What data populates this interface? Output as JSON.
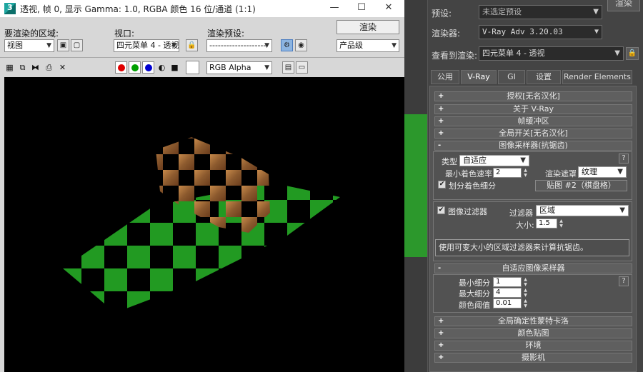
{
  "framebuffer": {
    "title": "透视, 帧 0, 显示 Gamma: 1.0, RGBA 颜色 16 位/通道 (1:1)",
    "controls": {
      "area_label": "要渲染的区域:",
      "area_value": "视图",
      "viewport_label": "视口:",
      "viewport_value": "四元菜单 4 - 透视",
      "preset_label": "渲染预设:",
      "preset_value": "--------------------",
      "render_button": "渲染",
      "quality_value": "产品级",
      "channel_value": "RGB Alpha"
    },
    "channel_colors": {
      "red": "#e00000",
      "green": "#00a000",
      "blue": "#0000d0"
    }
  },
  "render_setup": {
    "preset_label": "预设:",
    "preset_value": "未选定预设",
    "renderer_label": "渲染器:",
    "renderer_value": "V-Ray Adv 3.20.03",
    "view_label": "查看到渲染:",
    "view_value": "四元菜单 4 - 透视",
    "render_button": "渲染",
    "tabs": [
      "公用",
      "V-Ray",
      "GI",
      "设置",
      "Render Elements"
    ],
    "active_tab": "V-Ray",
    "rollouts_top": [
      {
        "sign": "+",
        "label": "授权[无名汉化]"
      },
      {
        "sign": "+",
        "label": "关于 V-Ray"
      },
      {
        "sign": "+",
        "label": "帧缓冲区"
      },
      {
        "sign": "+",
        "label": "全局开关[无名汉化]"
      },
      {
        "sign": "-",
        "label": "图像采样器(抗锯齿)"
      }
    ],
    "image_sampler": {
      "type_label": "类型",
      "type_value": "自适应",
      "min_shading_label": "最小着色速率",
      "min_shading_value": "2",
      "render_mask_label": "渲染遮罩",
      "render_mask_value": "纹理",
      "subdivide_label": "划分着色细分",
      "subdivide_checked": "✔",
      "map_button": "贴图 #2（棋盘格）",
      "help": "?"
    },
    "image_filter": {
      "enable_label": "图像过滤器",
      "enable_checked": "✔",
      "filter_label": "过滤器",
      "filter_value": "区域",
      "size_label": "大小:",
      "size_value": "1.5",
      "description": "使用可变大小的区域过滤器来计算抗锯齿。"
    },
    "adaptive_rollout": {
      "sign": "-",
      "label": "自适应图像采样器"
    },
    "adaptive": {
      "min_subdiv_label": "最小细分",
      "min_subdiv_value": "1",
      "max_subdiv_label": "最大细分",
      "max_subdiv_value": "4",
      "threshold_label": "颜色阈值",
      "threshold_value": "0.01",
      "help": "?"
    },
    "rollouts_bottom": [
      {
        "sign": "+",
        "label": "全局确定性蒙特卡洛"
      },
      {
        "sign": "+",
        "label": "颜色贴图"
      },
      {
        "sign": "+",
        "label": "环境"
      },
      {
        "sign": "+",
        "label": "摄影机"
      }
    ]
  }
}
